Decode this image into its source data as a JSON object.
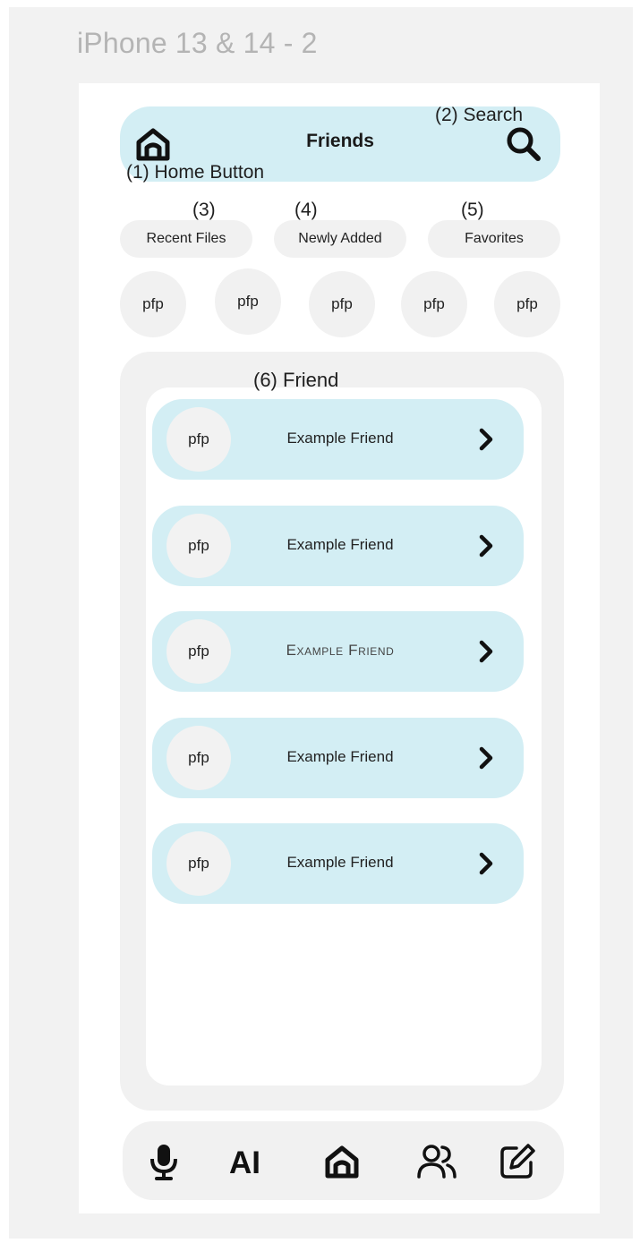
{
  "frame": {
    "label": "iPhone 13 & 14 - 2"
  },
  "annotations": {
    "home": "(1) Home Button",
    "search": "(2) Search",
    "recent": "(3)",
    "newly": "(4)",
    "favorites": "(5)",
    "friend": "(6)  Friend"
  },
  "header": {
    "title": "Friends",
    "home_icon": "home-icon",
    "search_icon": "search-icon"
  },
  "filters": [
    "Recent Files",
    "Newly Added",
    "Favorites"
  ],
  "avatars": [
    "pfp",
    "pfp",
    "pfp",
    "pfp",
    "pfp"
  ],
  "friends": [
    {
      "avatar": "pfp",
      "name": "Example Friend"
    },
    {
      "avatar": "pfp",
      "name": "Example Friend"
    },
    {
      "avatar": "pfp",
      "name": "Example Friend"
    },
    {
      "avatar": "pfp",
      "name": "Example Friend"
    },
    {
      "avatar": "pfp",
      "name": "Example Friend"
    }
  ],
  "bottom_nav": {
    "ai_label": "AI",
    "icons": [
      "microphone-icon",
      "ai-label",
      "home-icon",
      "people-icon",
      "edit-icon"
    ]
  },
  "colors": {
    "accent": "#d3eef4",
    "surface": "#f1f1f1",
    "background": "#ffffff"
  }
}
